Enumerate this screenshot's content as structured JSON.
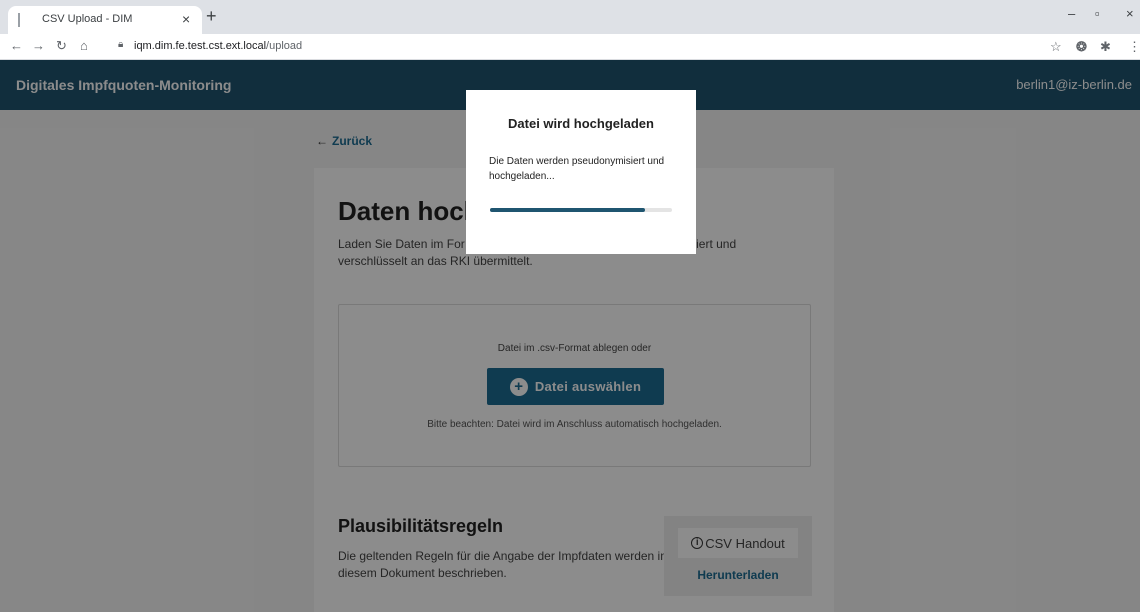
{
  "browser": {
    "tab_title": "CSV Upload - DIM",
    "tab_close": "×",
    "new_tab": "+",
    "url_host": "iqm.dim.fe.test.cst.ext.local",
    "url_path": "/upload",
    "controls": {
      "minimize": "–",
      "maximize": "▫",
      "close": "×"
    }
  },
  "header": {
    "title": "Digitales Impfquoten-Monitoring",
    "user_email": "berlin1@iz-berlin.de"
  },
  "page": {
    "back_label": "Zurück",
    "title": "Daten hoch",
    "intro": "Laden Sie Daten im For                                                              ymisiert und verschlüsselt an das RKI übermittelt."
  },
  "dropzone": {
    "text": "Datei im .csv-Format ablegen oder",
    "button_label": "Datei auswählen",
    "note": "Bitte beachten: Datei wird im Anschluss automatisch hochgeladen."
  },
  "rules": {
    "title": "Plausibilitätsregeln",
    "text": "Die geltenden Regeln für die Angabe der Impfdaten werden in diesem Dokument beschrieben.",
    "handout_label": "CSV Handout",
    "download_label": "Herunterladen"
  },
  "modal": {
    "title": "Datei wird hochgeladen",
    "text": "Die Daten werden pseudonymisiert und hochgeladen...",
    "progress": 0.85
  }
}
